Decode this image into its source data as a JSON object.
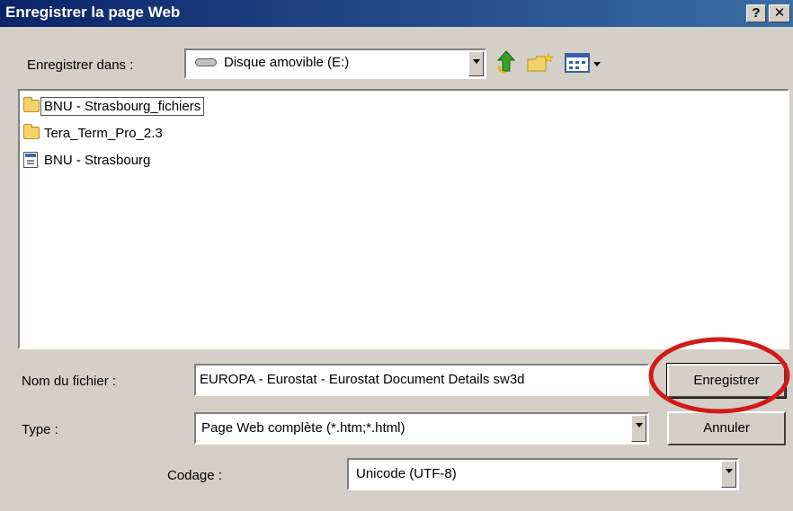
{
  "window": {
    "title": "Enregistrer la page Web",
    "help_glyph": "?",
    "close_glyph": "✕"
  },
  "save_in": {
    "label": "Enregistrer dans :",
    "value": "Disque amovible (E:)"
  },
  "toolbar": {
    "up_icon": "up-folder-icon",
    "new_folder_icon": "new-folder-icon",
    "view_menu_icon": "view-menu-icon"
  },
  "files": [
    {
      "name": "BNU - Strasbourg_fichiers",
      "icon": "folder-icon",
      "selected": true
    },
    {
      "name": "Tera_Term_Pro_2.3",
      "icon": "folder-icon",
      "selected": false
    },
    {
      "name": "BNU - Strasbourg",
      "icon": "html-document-icon",
      "selected": false
    }
  ],
  "filename": {
    "label": "Nom du fichier :",
    "value": "EUROPA - Eurostat - Eurostat Document Details sw3d"
  },
  "type": {
    "label": "Type :",
    "value": "Page Web complète (*.htm;*.html)"
  },
  "encoding": {
    "label": "Codage :",
    "value": "Unicode (UTF-8)"
  },
  "buttons": {
    "save": "Enregistrer",
    "cancel": "Annuler"
  },
  "colors": {
    "title_bar": "#0a246a",
    "dialog_face": "#d4d0c8",
    "highlight_circle": "#d21a1a"
  }
}
